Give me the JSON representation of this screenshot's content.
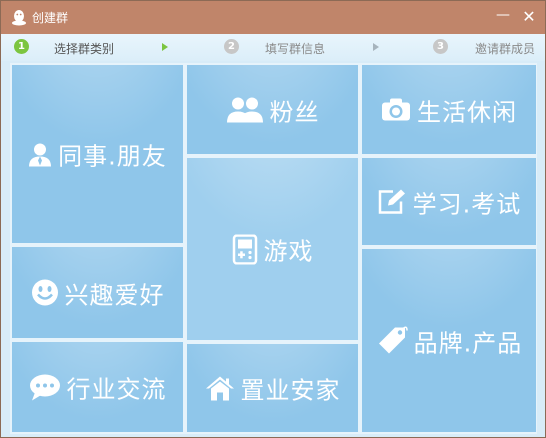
{
  "window": {
    "title": "创建群",
    "minimize_glyph": "—",
    "close_glyph": "✕"
  },
  "steps": [
    {
      "num": "1",
      "label": "选择群类别",
      "active": true
    },
    {
      "num": "2",
      "label": "填写群信息",
      "active": false
    },
    {
      "num": "3",
      "label": "邀请群成员",
      "active": false
    }
  ],
  "categories": {
    "colleagues_friends": {
      "label": "同事.朋友",
      "icon": "person-icon"
    },
    "fans": {
      "label": "粉丝",
      "icon": "two-people-icon"
    },
    "life_leisure": {
      "label": "生活休闲",
      "icon": "camera-icon"
    },
    "games": {
      "label": "游戏",
      "icon": "gamepad-icon"
    },
    "study_exam": {
      "label": "学习.考试",
      "icon": "edit-icon"
    },
    "hobbies": {
      "label": "兴趣爱好",
      "icon": "smiley-icon"
    },
    "brand_product": {
      "label": "品牌.产品",
      "icon": "tag-icon"
    },
    "industry_exchange": {
      "label": "行业交流",
      "icon": "chat-bubble-icon"
    },
    "home_property": {
      "label": "置业安家",
      "icon": "house-icon"
    }
  }
}
